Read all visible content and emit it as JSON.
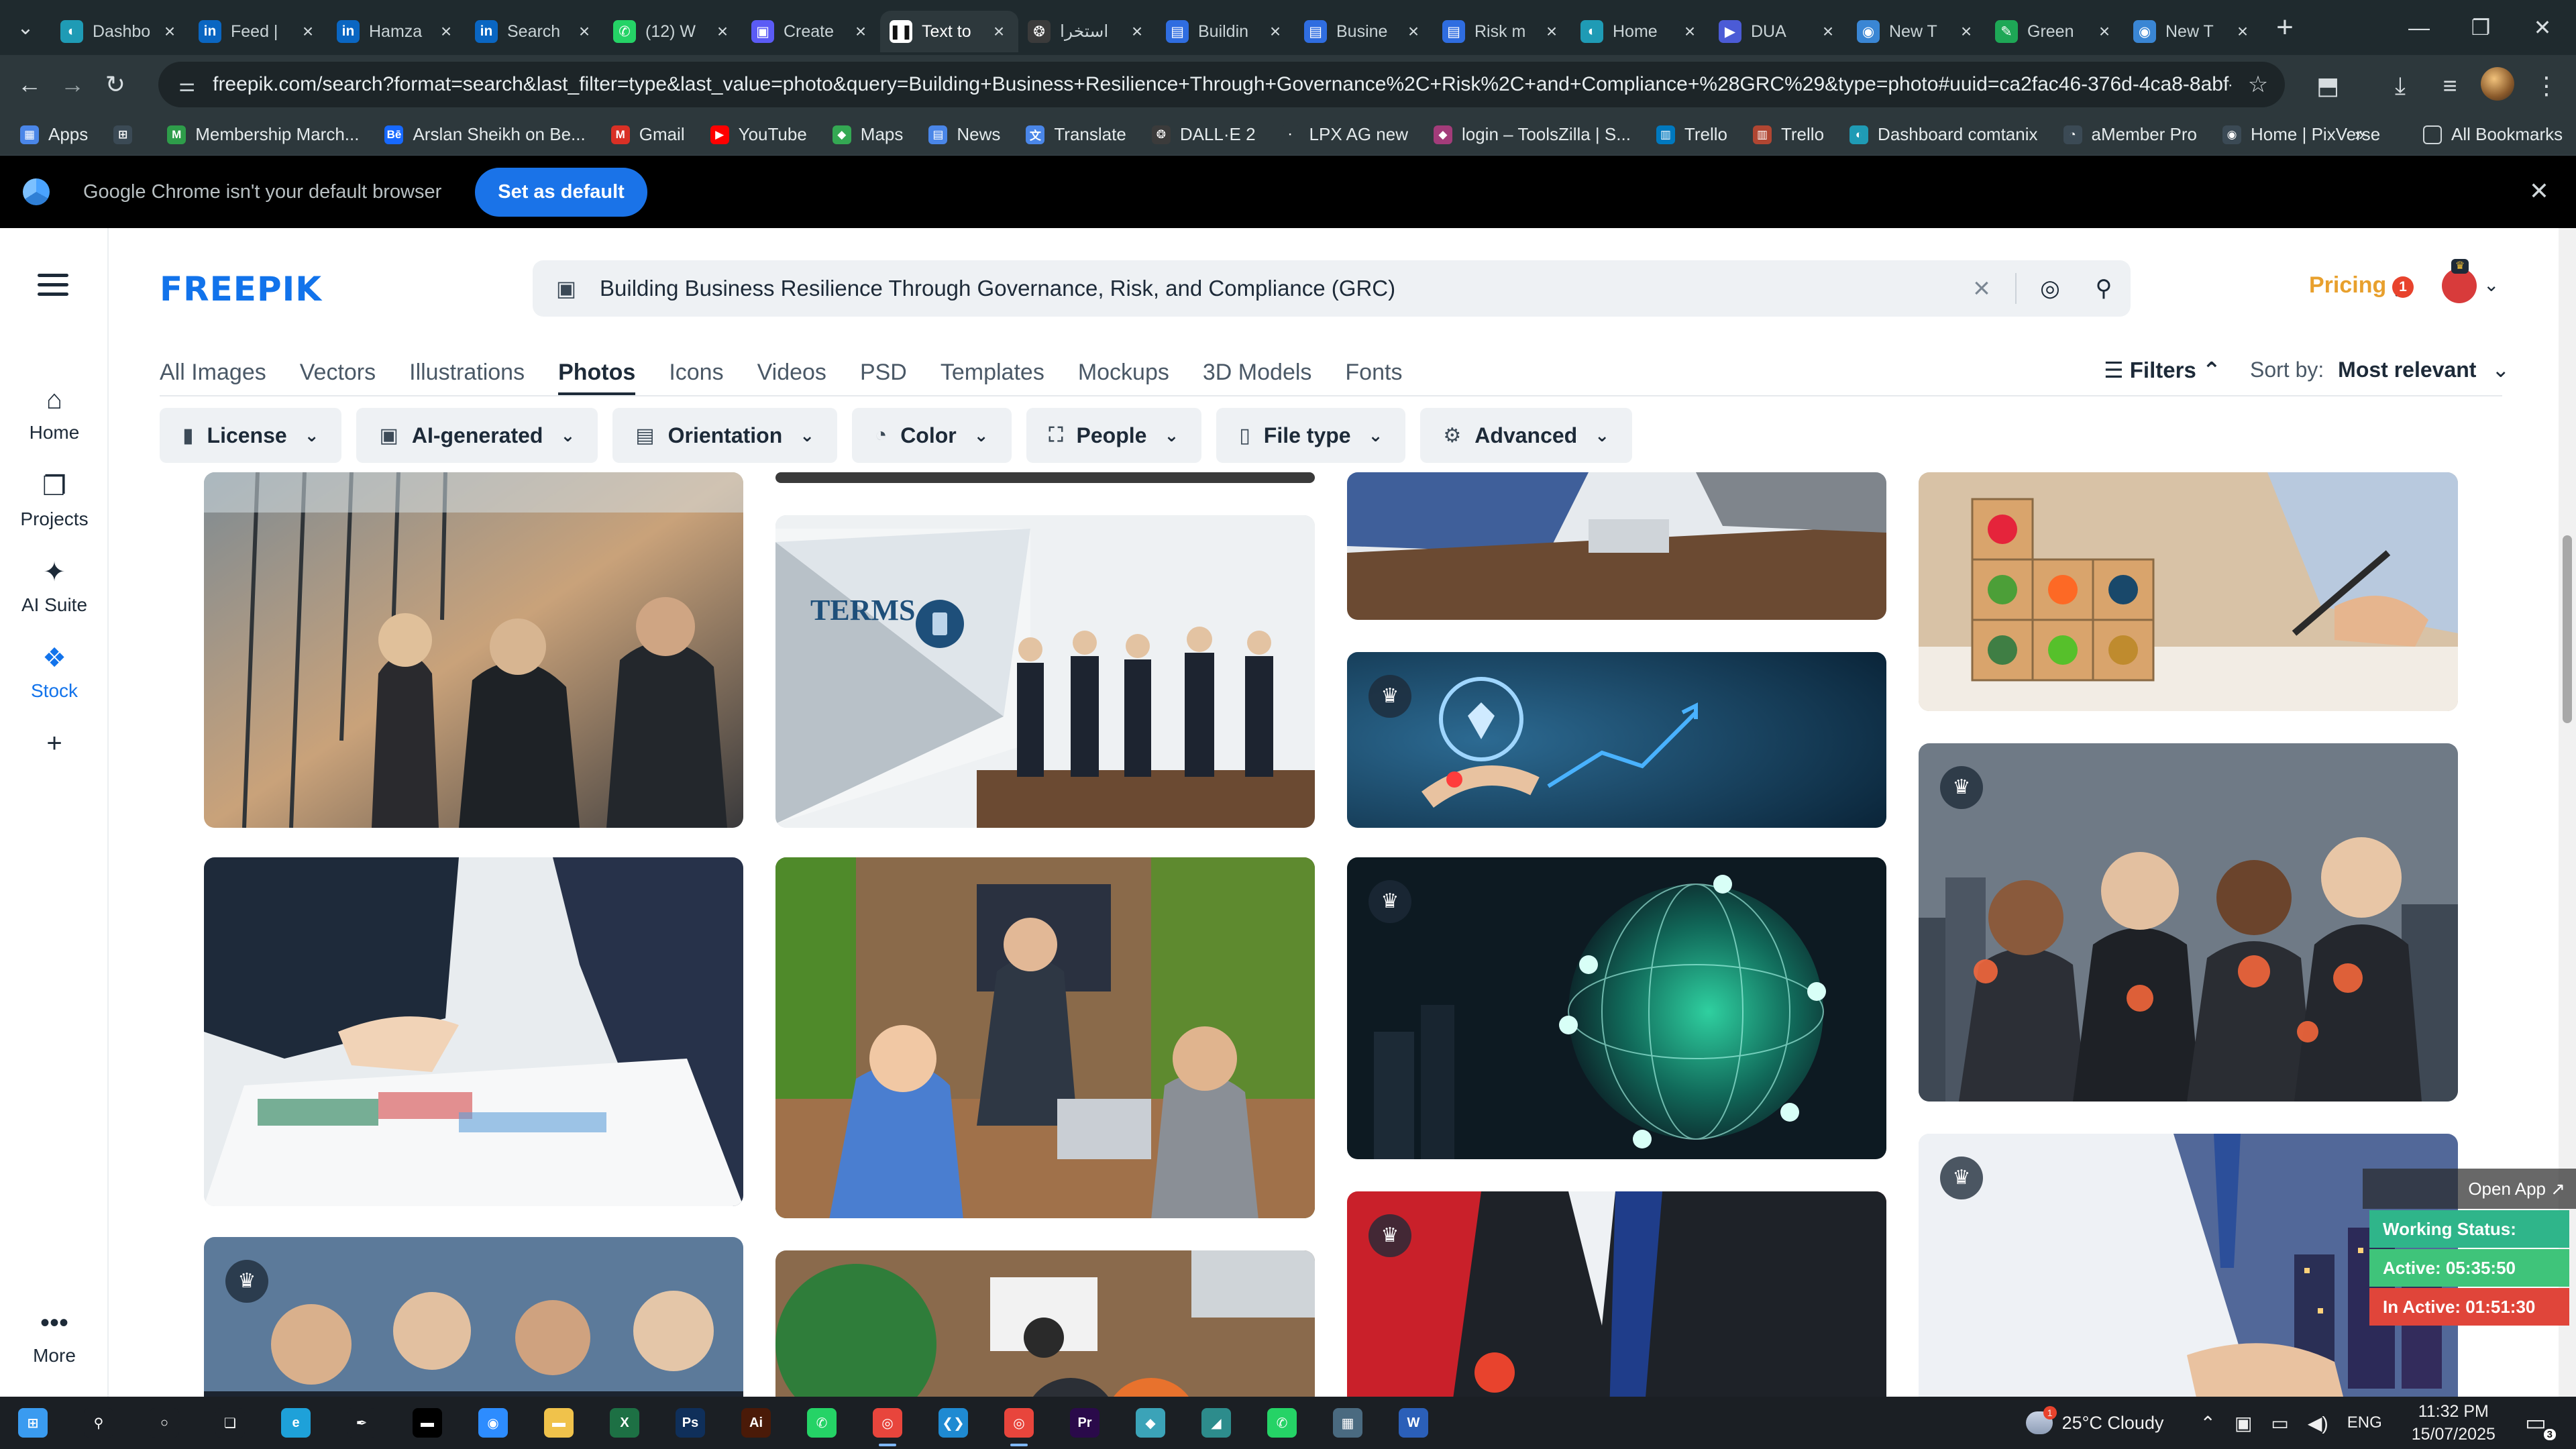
{
  "browser": {
    "tabs": [
      {
        "title": "Dashbo",
        "icon": "generic-app-icon",
        "color": "#1f9bb5",
        "glyph": "◐"
      },
      {
        "title": "Feed |",
        "icon": "linkedin-icon",
        "color": "#0a66c2",
        "glyph": "in"
      },
      {
        "title": "Hamza",
        "icon": "linkedin-icon",
        "color": "#0a66c2",
        "glyph": "in"
      },
      {
        "title": "Search",
        "icon": "linkedin-icon",
        "color": "#0a66c2",
        "glyph": "in"
      },
      {
        "title": "(12) W",
        "icon": "whatsapp-icon",
        "color": "#25d366",
        "glyph": "✆"
      },
      {
        "title": "Create",
        "icon": "canva-icon",
        "color": "#5b5bf5",
        "glyph": "▣"
      },
      {
        "title": "Text to",
        "icon": "pause-app-icon",
        "color": "#ffffff",
        "glyph": "❚❚",
        "active": true
      },
      {
        "title": "استخرا",
        "icon": "openai-icon",
        "color": "#3b3b3b",
        "glyph": "❂"
      },
      {
        "title": "Buildin",
        "icon": "document-icon",
        "color": "#2f6de0",
        "glyph": "▤"
      },
      {
        "title": "Busine",
        "icon": "document-icon",
        "color": "#2f6de0",
        "glyph": "▤"
      },
      {
        "title": "Risk m",
        "icon": "document-icon",
        "color": "#2f6de0",
        "glyph": "▤"
      },
      {
        "title": "Home",
        "icon": "generic-app-icon",
        "color": "#1f9bb5",
        "glyph": "◐"
      },
      {
        "title": "DUA",
        "icon": "app-icon",
        "color": "#4b5bd6",
        "glyph": "▶"
      },
      {
        "title": "New T",
        "icon": "globe-icon",
        "color": "#3a86d4",
        "glyph": "◉"
      },
      {
        "title": "Green",
        "icon": "leaf-icon",
        "color": "#1ea756",
        "glyph": "✎"
      },
      {
        "title": "New T",
        "icon": "globe-icon",
        "color": "#3a86d4",
        "glyph": "◉"
      }
    ],
    "url": "freepik.com/search?format=search&last_filter=type&last_value=photo&query=Building+Business+Resilience+Through+Governance%2C+Risk%2C+and+Compliance+%28GRC%29&type=photo#uuid=ca2fac46-376d-4ca8-8abf-f91f3712acd7",
    "bookmarks": [
      {
        "label": "Apps",
        "icon": "apps-grid-icon",
        "color": "#4a86e8",
        "glyph": "▦"
      },
      {
        "label": "",
        "icon": "grid-icon",
        "color": "#3b4a55",
        "glyph": "⊞"
      },
      {
        "label": "Membership March...",
        "icon": "bookmark-app-icon",
        "color": "#2e9d4a",
        "glyph": "M"
      },
      {
        "label": "Arslan Sheikh on Be...",
        "icon": "behance-icon",
        "color": "#1769ff",
        "glyph": "Bē"
      },
      {
        "label": "Gmail",
        "icon": "gmail-icon",
        "color": "#d93025",
        "glyph": "M"
      },
      {
        "label": "YouTube",
        "icon": "youtube-icon",
        "color": "#ff0000",
        "glyph": "▶"
      },
      {
        "label": "Maps",
        "icon": "maps-icon",
        "color": "#34a853",
        "glyph": "◆"
      },
      {
        "label": "News",
        "icon": "news-icon",
        "color": "#4a86e8",
        "glyph": "▤"
      },
      {
        "label": "Translate",
        "icon": "translate-icon",
        "color": "#4a86e8",
        "glyph": "文"
      },
      {
        "label": "DALL·E 2",
        "icon": "openai-icon",
        "color": "#3b3b3b",
        "glyph": "❂"
      },
      {
        "label": "LPX AG new",
        "icon": "bookmark-app-icon",
        "color": "#2d383c",
        "glyph": "·"
      },
      {
        "label": "login – ToolsZilla | S...",
        "icon": "toolszilla-icon",
        "color": "#a33c7a",
        "glyph": "◆"
      },
      {
        "label": "Trello",
        "icon": "trello-icon",
        "color": "#0079bf",
        "glyph": "▥"
      },
      {
        "label": "Trello",
        "icon": "trello-icon",
        "color": "#b04632",
        "glyph": "▥"
      },
      {
        "label": "Dashboard comtanix",
        "icon": "generic-app-icon",
        "color": "#1f9bb5",
        "glyph": "◐"
      },
      {
        "label": "aMember Pro",
        "icon": "amember-icon",
        "color": "#3b4a55",
        "glyph": "◔"
      },
      {
        "label": "Home | PixVerse",
        "icon": "pixverse-icon",
        "color": "#3b4a55",
        "glyph": "◉"
      }
    ],
    "all_bookmarks": "All Bookmarks",
    "infobar_message": "Google Chrome isn't your default browser",
    "infobar_button": "Set as default"
  },
  "freepik": {
    "logo": "FREEPIK",
    "rail": [
      {
        "label": "Home",
        "icon": "home-icon",
        "glyph": "⌂"
      },
      {
        "label": "Projects",
        "icon": "projects-icon",
        "glyph": "❐"
      },
      {
        "label": "AI Suite",
        "icon": "ai-sparkle-icon",
        "glyph": "✦"
      },
      {
        "label": "Stock",
        "icon": "stock-icon",
        "glyph": "❖",
        "active": true
      },
      {
        "label": "",
        "icon": "plus-icon",
        "glyph": "+"
      },
      {
        "label": "More",
        "icon": "more-dots-icon",
        "glyph": "•••"
      }
    ],
    "search_query": "Building Business Resilience Through Governance, Risk, and Compliance (GRC)",
    "pricing": "Pricing",
    "notification_count": "1",
    "type_tabs": [
      "All Images",
      "Vectors",
      "Illustrations",
      "Photos",
      "Icons",
      "Videos",
      "PSD",
      "Templates",
      "Mockups",
      "3D Models",
      "Fonts"
    ],
    "active_type_tab": "Photos",
    "filters_label": "Filters",
    "sort_label": "Sort by:",
    "sort_value": "Most relevant",
    "filter_chips": [
      {
        "label": "License",
        "icon": "license-icon",
        "glyph": "▮"
      },
      {
        "label": "AI-generated",
        "icon": "ai-generated-icon",
        "glyph": "▣"
      },
      {
        "label": "Orientation",
        "icon": "orientation-icon",
        "glyph": "▤"
      },
      {
        "label": "Color",
        "icon": "palette-icon",
        "glyph": "◔"
      },
      {
        "label": "People",
        "icon": "people-icon",
        "glyph": "⛶"
      },
      {
        "label": "File type",
        "icon": "file-icon",
        "glyph": "▯"
      },
      {
        "label": "Advanced",
        "icon": "settings-icon",
        "glyph": "⚙"
      }
    ],
    "photo_text": {
      "terms": "TERMS"
    },
    "tracker": {
      "open_app": "Open App ↗",
      "status": "Working Status: Active",
      "active": "Active: 05:35:50",
      "inactive": "In Active: 01:51:30",
      "colors": {
        "status": "#2fb58a",
        "active": "#3fc47a",
        "inactive": "#e0453a"
      }
    }
  },
  "taskbar": {
    "apps": [
      {
        "name": "windows-start-icon",
        "color": "#3a9bf0",
        "glyph": "⊞"
      },
      {
        "name": "search-icon",
        "color": "#1b1f24",
        "glyph": "⚲"
      },
      {
        "name": "cortana-icon",
        "color": "#1b1f24",
        "glyph": "○"
      },
      {
        "name": "task-view-icon",
        "color": "#1b1f24",
        "glyph": "❏"
      },
      {
        "name": "edge-icon",
        "color": "#1ea1d9",
        "glyph": "e"
      },
      {
        "name": "pen-icon",
        "color": "#1b1f24",
        "glyph": "✒"
      },
      {
        "name": "terminal-icon",
        "color": "#000000",
        "glyph": "▬"
      },
      {
        "name": "zoom-icon",
        "color": "#2d8cff",
        "glyph": "◉"
      },
      {
        "name": "file-explorer-icon",
        "color": "#f0c24b",
        "glyph": "▬"
      },
      {
        "name": "excel-icon",
        "color": "#1d7044",
        "glyph": "X"
      },
      {
        "name": "photoshop-icon",
        "color": "#0f2f5a",
        "glyph": "Ps"
      },
      {
        "name": "illustrator-icon",
        "color": "#4a1a08",
        "glyph": "Ai"
      },
      {
        "name": "whatsapp-icon",
        "color": "#25d366",
        "glyph": "✆"
      },
      {
        "name": "chrome-icon",
        "color": "#e8453c",
        "glyph": "◎"
      },
      {
        "name": "vscode-icon",
        "color": "#1f8ad2",
        "glyph": "❮❯"
      },
      {
        "name": "chrome-profile-icon",
        "color": "#e8453c",
        "glyph": "◎"
      },
      {
        "name": "premiere-icon",
        "color": "#2a0a4a",
        "glyph": "Pr"
      },
      {
        "name": "app-icon",
        "color": "#3ba3b8",
        "glyph": "◆"
      },
      {
        "name": "app-icon",
        "color": "#2d8c8c",
        "glyph": "◢"
      },
      {
        "name": "whatsapp-icon",
        "color": "#25d366",
        "glyph": "✆"
      },
      {
        "name": "calculator-icon",
        "color": "#4a6a80",
        "glyph": "▦"
      },
      {
        "name": "word-icon",
        "color": "#2b5fb8",
        "glyph": "W"
      }
    ],
    "weather": "25°C  Cloudy",
    "weather_badge": "1",
    "language": "ENG",
    "time": "11:32 PM",
    "date": "15/07/2025",
    "notification_badge": "3"
  }
}
